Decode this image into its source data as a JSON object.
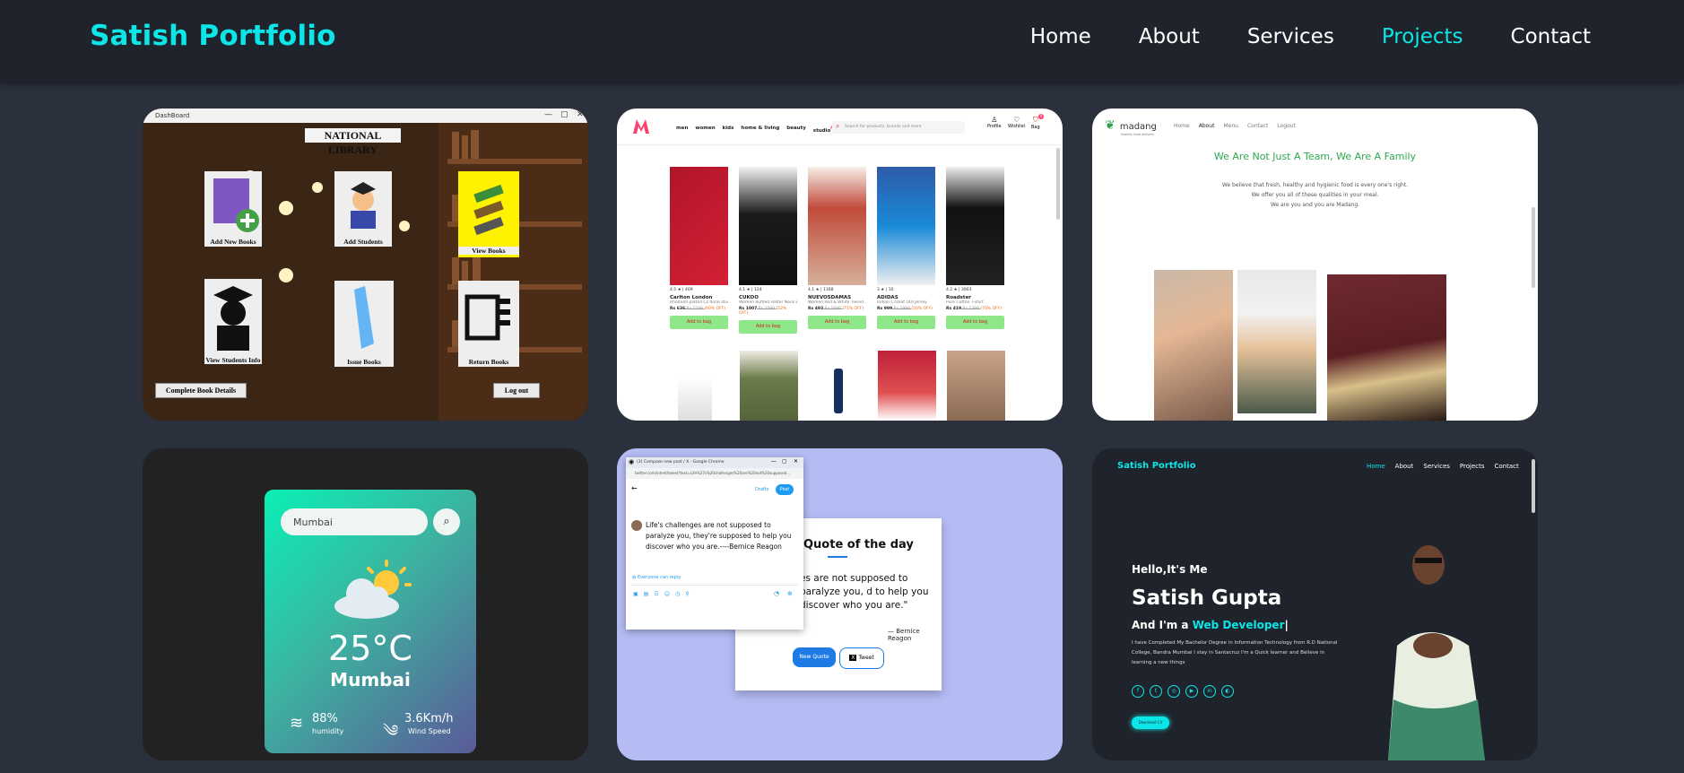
{
  "brand": "Satish Portfolio",
  "nav": [
    "Home",
    "About",
    "Services",
    "Projects",
    "Contact"
  ],
  "colors": {
    "accent": "#0ce6e8",
    "nav_bg": "#1f232b",
    "page_bg": "#2b303d"
  },
  "library": {
    "window_title": "DashBoard",
    "title": "NATIONAL LIBRARY",
    "tiles": [
      "Add New Books",
      "Add Students",
      "View Books",
      "View Students Info",
      "Issue Books",
      "Return Books"
    ],
    "complete": "Complete Book Details",
    "logout": "Log out"
  },
  "shop": {
    "nav": [
      "men",
      "women",
      "kids",
      "home & living",
      "beauty",
      "studio"
    ],
    "new_badge": "NEW",
    "search_placeholder": "Search for products, brands and more",
    "icons": [
      "Profile",
      "Wishlist",
      "Bag"
    ],
    "bag_count": "0",
    "products": [
      {
        "rating": "4.5 ★ | 409",
        "brand": "Carlton London",
        "desc": "Rhodium-plated Cz floral studs",
        "price": "Rs 636",
        "mrp": "Rs 1599",
        "off": "(60% OFF)",
        "cta": "Add to bag"
      },
      {
        "rating": "4.1 ★ | 124",
        "brand": "CUKOO",
        "desc": "Women Ruffled Halter Neck E...",
        "price": "Rs 1007",
        "mrp": "Rs 2099",
        "off": "(52% OFF)",
        "cta": "Add to bag"
      },
      {
        "rating": "4.1 ★ | 1168",
        "brand": "NUEVOSDAMAS",
        "desc": "Women Red & White Tiered ...",
        "price": "Rs 493",
        "mrp": "Rs 1699",
        "off": "(71% OFF)",
        "cta": "Add to bag"
      },
      {
        "rating": "3 ★ | 10",
        "brand": "ADIDAS",
        "desc": "Indian Cricket ODI Jersey",
        "price": "Rs 999",
        "mrp": "Rs 1999",
        "off": "(50% OFF)",
        "cta": "Add to bag"
      },
      {
        "rating": "4.2 ★ | 3903",
        "brand": "Roadster",
        "desc": "Pure Cotton T-shirt",
        "price": "Rs 419",
        "mrp": "Rs 1399",
        "off": "(70% OFF)",
        "cta": "Add to bag"
      }
    ]
  },
  "madang": {
    "logo": "madang",
    "logo_sub": "healthy food delivery",
    "nav": [
      "Home",
      "About",
      "Menu",
      "Contact",
      "Logout"
    ],
    "heading": "We Are Not Just A Team, We Are A Family",
    "lines": [
      "We believe that fresh, healthy and hygienic food is every one's right.",
      "We offer you all of these qualities in your meal.",
      "We are you and you are Madang."
    ]
  },
  "weather": {
    "search_value": "Mumbai",
    "temp": "25°C",
    "city": "Mumbai",
    "humidity_val": "88%",
    "humidity_label": "humidity",
    "wind_val": "3.6Km/h",
    "wind_label": "Wind Speed"
  },
  "quote": {
    "tab_title": "(3) Compose new post / X - Google Chrome",
    "url": "twitter.com/intent/tweet?text=Life%27s%20challenges%20are%20not%20supposed...",
    "drafts": "Drafts",
    "post": "Post",
    "tweet_text": "Life's challenges are not supposed to paralyze you, they're supposed to help you discover who you are.----Bernice Reagon",
    "reply": "Everyone can reply",
    "card_title": "Quote of the day",
    "card_quote": "es are not supposed to paralyze you, d to help you discover who you are.\"",
    "author": "— Bernice Reagon",
    "new_quote": "New Quote",
    "tweet_btn": "Tweet"
  },
  "portfolio": {
    "brand": "Satish Portfolio",
    "nav": [
      "Home",
      "About",
      "Services",
      "Projects",
      "Contact"
    ],
    "hello": "Hello,It's Me",
    "name": "Satish Gupta",
    "role_prefix": "And I'm a",
    "role": "Web Developer",
    "bio": "I have Completed My Bachelor Degree in Information Technology from R.D National College, Bandra Mumbai I stay in Santacruz I'm a Quick learner and Believe in learning a new things",
    "button": "Download CV"
  }
}
